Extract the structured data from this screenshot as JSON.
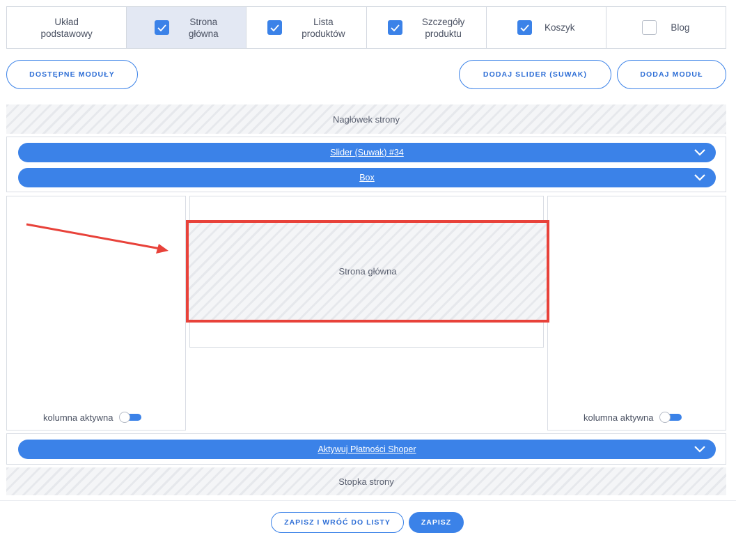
{
  "tabs": [
    {
      "label": "Układ\npodstawowy",
      "checkbox": "none",
      "active": false
    },
    {
      "label": "Strona\ngłówna",
      "checkbox": "checked",
      "active": true
    },
    {
      "label": "Lista\nproduktów",
      "checkbox": "checked",
      "active": false
    },
    {
      "label": "Szczegóły\nproduktu",
      "checkbox": "checked",
      "active": false
    },
    {
      "label": "Koszyk",
      "checkbox": "checked",
      "active": false
    },
    {
      "label": "Blog",
      "checkbox": "unchecked",
      "active": false
    }
  ],
  "actions": {
    "available_modules": "DOSTĘPNE MODUŁY",
    "add_slider": "DODAJ SLIDER (SUWAK)",
    "add_module": "DODAJ MODUŁ"
  },
  "layout": {
    "header_label": "Nagłówek strony",
    "top_modules": [
      "Slider (Suwak) #34",
      "Box"
    ],
    "main_area_label": "Strona główna",
    "left_column_label": "kolumna aktywna",
    "right_column_label": "kolumna aktywna",
    "bottom_module": "Aktywuj Płatności Shoper",
    "footer_label": "Stopka strony"
  },
  "footer": {
    "save_return": "ZAPISZ I WRÓĆ DO LISTY",
    "save": "ZAPISZ"
  },
  "colors": {
    "accent": "#3b82e8",
    "highlight": "#e8423a",
    "active_tab": "#e3e8f3"
  },
  "icons": {
    "checkbox": "check-icon",
    "module_expand": "chevron-down-icon",
    "annotation": "arrow-icon"
  }
}
